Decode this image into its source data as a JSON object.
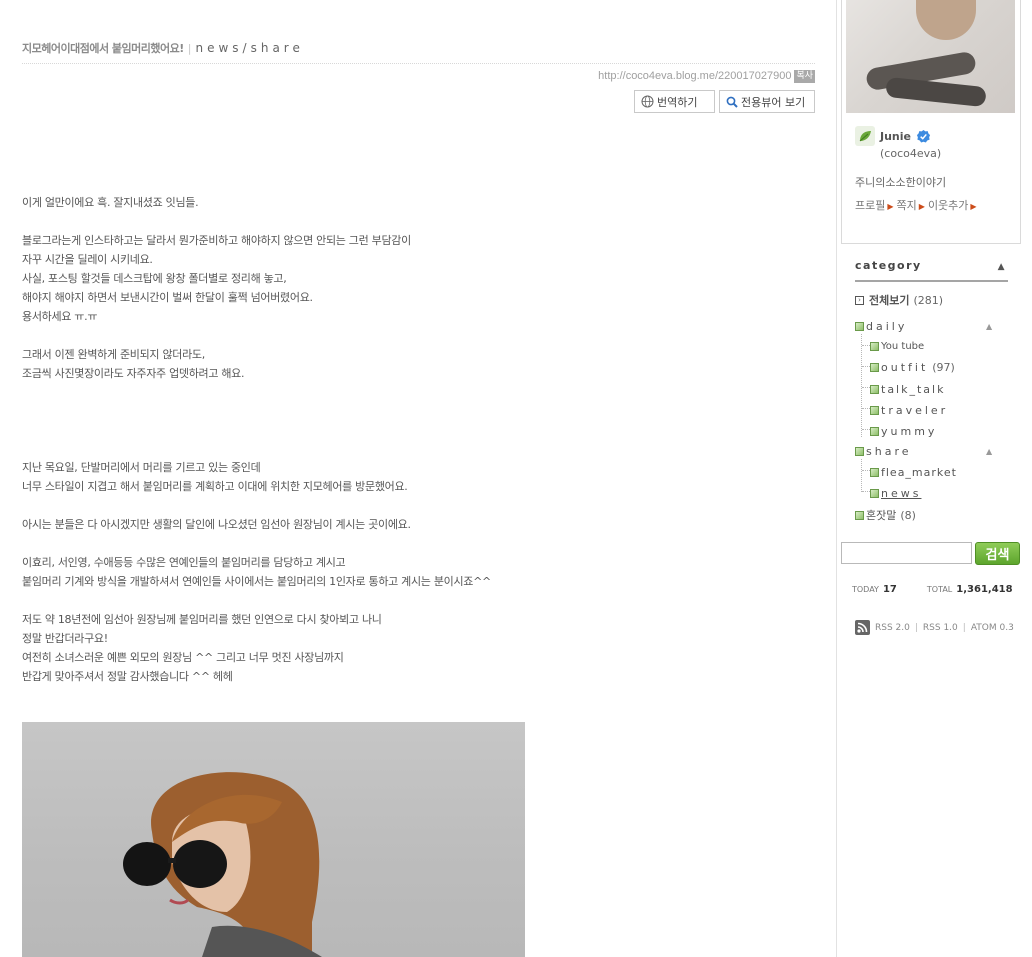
{
  "post": {
    "title": "지모헤어이대점에서 붙임머리했어요!",
    "category": "news/share",
    "url": "http://coco4eva.blog.me/220017027900",
    "copy_label": "복사",
    "translate_label": "번역하기",
    "viewer_label": "전용뷰어 보기"
  },
  "body": {
    "l1": "이게 얼만이에요 흑. 잘지내셨죠 잇님들.",
    "l2": "블로그라는게 인스타하고는 달라서 뭔가준비하고 해야하지 않으면 안되는 그런 부담감이",
    "l3": "자꾸 시간을 딜레이 시키네요.",
    "l4": "사실, 포스팅 할것들 데스크탑에 왕창 폴더별로 정리해 놓고,",
    "l5": "해야지 해야지 하면서 보낸시간이 벌써 한달이 훌쩍 넘어버렸어요.",
    "l6": "용서하세요 ㅠ.ㅠ",
    "l7": "그래서 이젠 완벽하게 준비되지 않더라도,",
    "l8": "조금씩 사진몇장이라도 자주자주 업뎃하려고 해요.",
    "l9": "지난 목요일, 단발머리에서 머리를 기르고 있는 중인데",
    "l10": "너무 스타일이 지겹고 해서 붙임머리를 계획하고 이대에 위치한 지모헤어를 방문했어요.",
    "l11": "아시는 분들은 다 아시겠지만 생활의 달인에 나오셨던 임선아 원장님이 계시는 곳이에요.",
    "l12": "이효리, 서인영, 수애등등 수많은 연예인들의 붙임머리를 담당하고 계시고",
    "l13": "붙임머리 기계와 방식을 개발하셔서 연예인들 사이에서는 붙임머리의 1인자로 통하고 계시는 분이시죠^^",
    "l14": "저도 약 18년전에 임선아 원장님께 붙임머리를 했던 인연으로 다시 찾아뵈고 나니",
    "l15": "정말 반갑더라구요!",
    "l16": "여전히 소녀스러운 예쁜 외모의 원장님 ^^ 그리고 너무 멋진 사장님까지",
    "l17": "반갑게 맞아주셔서 정말 감사했습니다 ^^ 헤헤"
  },
  "profile": {
    "nickname": "Junie",
    "blog_id": "(coco4eva)",
    "description": "주니의소소한이야기",
    "link_profile": "프로필",
    "link_message": "쪽지",
    "link_neighbor": "이웃추가"
  },
  "category": {
    "header": "category",
    "all_label": "전체보기",
    "all_count": "(281)",
    "daily": "daily",
    "youtube": "You tube",
    "outfit": "outfit",
    "outfit_count": "(97)",
    "talk": "talk_talk",
    "traveler": "traveler",
    "yummy": "yummy",
    "share": "share",
    "flea": "flea_market",
    "news": "news",
    "monologue": "혼잣말",
    "monologue_count": "(8)"
  },
  "search": {
    "button": "검색",
    "placeholder": ""
  },
  "stats": {
    "today_label": "TODAY",
    "today": "17",
    "total_label": "TOTAL",
    "total": "1,361,418"
  },
  "feeds": {
    "rss2": "RSS 2.0",
    "rss1": "RSS 1.0",
    "atom": "ATOM 0.3",
    "sep": "|"
  },
  "icons": [
    "globe-icon",
    "magnifier-icon",
    "leaf-avatar-icon",
    "verified-badge-icon",
    "category-icon",
    "collapse-arrow-icon",
    "rss-icon"
  ],
  "colors": {
    "search_button": "#6bb33a",
    "link_arrow": "#cc4c1a"
  }
}
